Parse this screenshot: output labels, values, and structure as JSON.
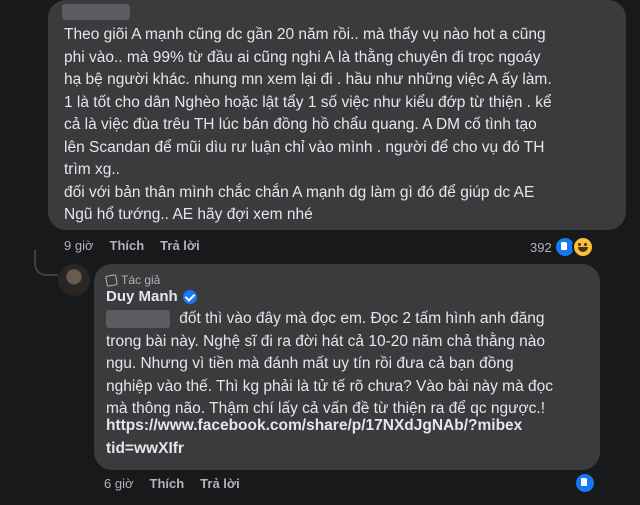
{
  "comment1": {
    "text": "Theo giõi A mạnh cũng dc gần 20 năm rồi.. mà thấy vụ nào hot a cũng\nphi vào.. mà 99% từ đầu ai cũng nghi A là thằng chuyên đi trọc ngoáy\nhạ bệ người khác. nhung mn xem lại đi . hầu như những việc A ấy làm.\n1 là tốt cho dân Nghèo hoặc lật tẩy 1 số việc như kiểu đớp từ thiện . kể\ncả là việc đùa trêu TH lúc bán đồng hồ chẩu quang. A DM cố tình tạo\nlên Scandan để mũi dìu rư luận chỉ vào mình . người để cho vụ đó TH\ntrìm xg..\nđối với bản thân mình chắc chắn A mạnh dg làm gì đó để giúp dc AE\nNgũ hổ tướng.. AE hãy đợi xem nhé",
    "time": "9 giờ",
    "like_label": "Thích",
    "reply_label": "Trả lời",
    "reaction_count": "392",
    "reactions": [
      "like-icon",
      "haha-icon"
    ]
  },
  "comment2": {
    "badge": "Tác giả",
    "author": "Duy Manh",
    "text": "                 đốt thì vào đây mà đọc em. Đọc 2 tấm hình anh đăng\ntrong bài này. Nghệ sĩ đi ra đời hát cả 10-20 năm chả thằng nào\nngu. Nhưng vì tiền mà đánh mất uy tín rồi đưa cả bạn đồng\nnghiệp vào thế. Thì kg phải là tử tế rõ chưa? Vào bài này mà đọc\nmà thông não. Thậm chí lấy cả vấn đề từ thiện ra để qc ngược.!",
    "link": "https://www.facebook.com/share/p/17NXdJgNAb/?mibextid=wwXIfr",
    "time": "6 giờ",
    "like_label": "Thích",
    "reply_label": "Trả lời",
    "reactions": [
      "like-icon"
    ]
  },
  "colors": {
    "background": "#18191a",
    "bubble": "#3a3b3c",
    "like_blue": "#1877f2"
  }
}
